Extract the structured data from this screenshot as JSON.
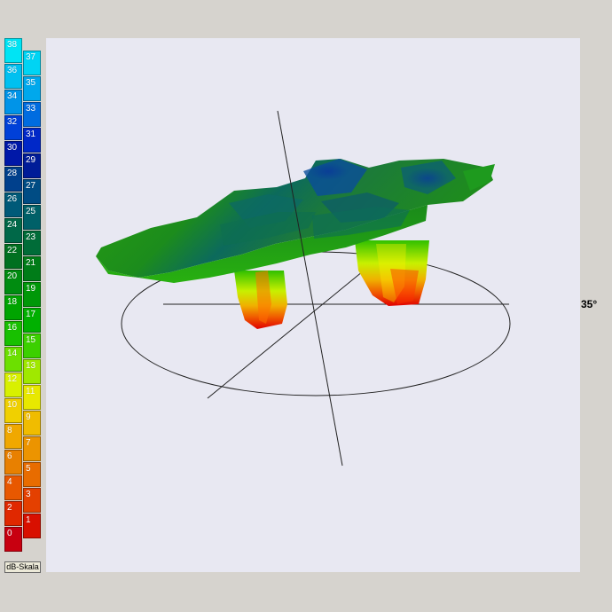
{
  "legend": {
    "label": "dB-Skala",
    "even_column": [
      {
        "value": "38",
        "color": "#00e4f4"
      },
      {
        "value": "36",
        "color": "#00c0f0"
      },
      {
        "value": "34",
        "color": "#0094e8"
      },
      {
        "value": "32",
        "color": "#0040d8"
      },
      {
        "value": "30",
        "color": "#0018a8"
      },
      {
        "value": "28",
        "color": "#00408c"
      },
      {
        "value": "26",
        "color": "#005a78"
      },
      {
        "value": "24",
        "color": "#006848"
      },
      {
        "value": "22",
        "color": "#007020"
      },
      {
        "value": "20",
        "color": "#008c10"
      },
      {
        "value": "18",
        "color": "#00a400"
      },
      {
        "value": "16",
        "color": "#18c000"
      },
      {
        "value": "14",
        "color": "#6ce000"
      },
      {
        "value": "12",
        "color": "#d8f000"
      },
      {
        "value": "10",
        "color": "#f0d000"
      },
      {
        "value": "8",
        "color": "#f0a800"
      },
      {
        "value": "6",
        "color": "#e88000"
      },
      {
        "value": "4",
        "color": "#e85800"
      },
      {
        "value": "2",
        "color": "#e02800"
      },
      {
        "value": "0",
        "color": "#c80010"
      }
    ],
    "odd_column": [
      {
        "value": "37",
        "color": "#00d4f4"
      },
      {
        "value": "35",
        "color": "#00a8ec"
      },
      {
        "value": "33",
        "color": "#006ce0"
      },
      {
        "value": "31",
        "color": "#0028c8"
      },
      {
        "value": "29",
        "color": "#001c98"
      },
      {
        "value": "27",
        "color": "#004c84"
      },
      {
        "value": "25",
        "color": "#006068"
      },
      {
        "value": "23",
        "color": "#006c38"
      },
      {
        "value": "21",
        "color": "#007c18"
      },
      {
        "value": "19",
        "color": "#009808"
      },
      {
        "value": "17",
        "color": "#00b000"
      },
      {
        "value": "15",
        "color": "#3cd000"
      },
      {
        "value": "13",
        "color": "#a0e800"
      },
      {
        "value": "11",
        "color": "#e8e800"
      },
      {
        "value": "9",
        "color": "#f0bc00"
      },
      {
        "value": "7",
        "color": "#ec9400"
      },
      {
        "value": "5",
        "color": "#e86c00"
      },
      {
        "value": "3",
        "color": "#e44000"
      },
      {
        "value": "1",
        "color": "#d81000"
      }
    ]
  },
  "plot": {
    "angle_label": "35°"
  }
}
